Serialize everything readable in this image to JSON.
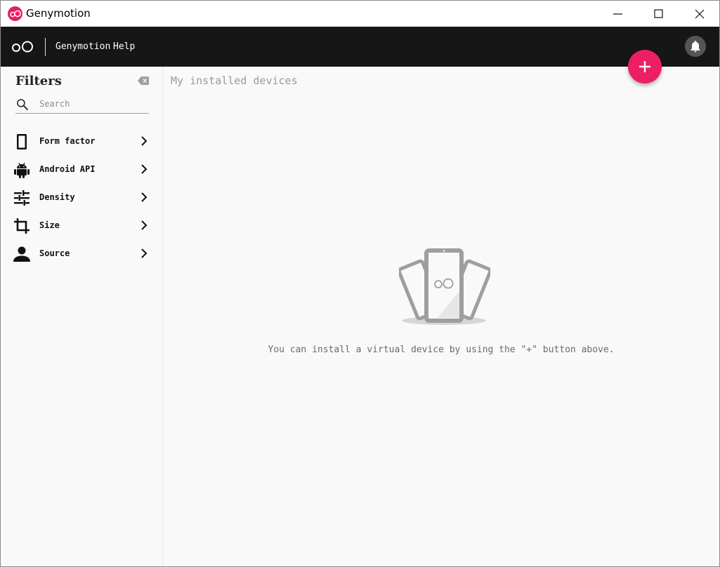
{
  "window": {
    "title": "Genymotion"
  },
  "toolbar": {
    "menu": [
      {
        "label": "Genymotion"
      },
      {
        "label": "Help"
      }
    ]
  },
  "sidebar": {
    "title": "Filters",
    "search": {
      "placeholder": "Search",
      "value": ""
    },
    "filters": [
      {
        "label": "Form factor",
        "icon": "phone-icon"
      },
      {
        "label": "Android API",
        "icon": "android-icon"
      },
      {
        "label": "Density",
        "icon": "sliders-icon"
      },
      {
        "label": "Size",
        "icon": "crop-icon"
      },
      {
        "label": "Source",
        "icon": "person-icon"
      }
    ]
  },
  "main": {
    "title": "My installed devices",
    "empty_message": "You can install a virtual device by using the \"+\" button above."
  },
  "colors": {
    "accent": "#ec1f63",
    "toolbar_bg": "#161616",
    "background": "#f9f9f9"
  }
}
